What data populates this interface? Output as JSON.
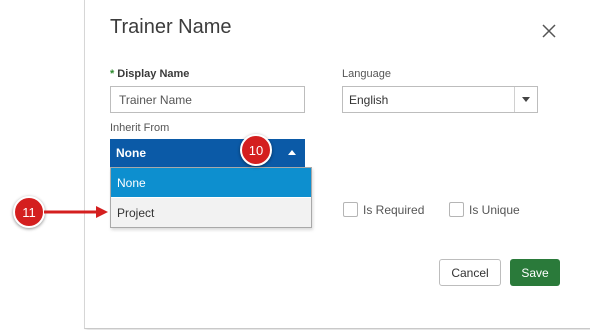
{
  "dialog": {
    "title": "Trainer Name",
    "close_icon": "close-icon"
  },
  "form": {
    "display_name": {
      "required_marker": "*",
      "label": "Display Name",
      "value": "Trainer Name"
    },
    "language": {
      "label": "Language",
      "value": "English"
    },
    "inherit_from": {
      "label": "Inherit From",
      "value": "None",
      "options": [
        "None",
        "Project"
      ]
    },
    "checkboxes": [
      {
        "label": "Is Required",
        "checked": false
      },
      {
        "label": "Is Unique",
        "checked": false
      }
    ]
  },
  "footer": {
    "cancel_label": "Cancel",
    "save_label": "Save"
  },
  "annotations": {
    "badge_10": "10",
    "badge_11": "11"
  },
  "colors": {
    "select_active": "#0b5aa7",
    "option_highlight": "#0d8fcf",
    "save_button": "#2a7a3a",
    "badge": "#d41f1f",
    "required_marker": "#2e8b2e"
  }
}
